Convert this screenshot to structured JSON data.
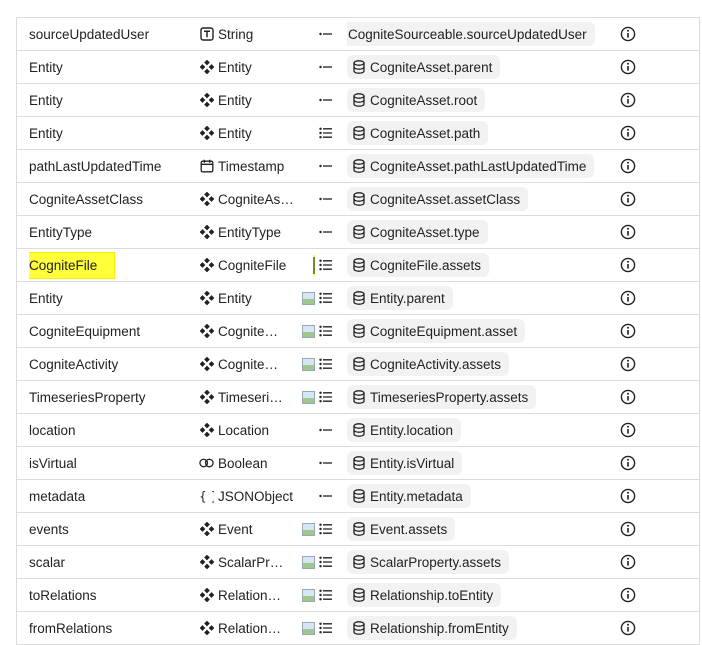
{
  "rows": [
    {
      "name": "sourceUpdatedUser",
      "type_icon": "text-icon",
      "type": "String",
      "indicator": "dash",
      "source": "CogniteSourceable.sourceUpdatedUser",
      "wide": true
    },
    {
      "name": "Entity",
      "type_icon": "node-icon",
      "type": "Entity",
      "indicator": "dash",
      "source": "CogniteAsset.parent"
    },
    {
      "name": "Entity",
      "type_icon": "node-icon",
      "type": "Entity",
      "indicator": "dash",
      "source": "CogniteAsset.root"
    },
    {
      "name": "Entity",
      "type_icon": "node-icon",
      "type": "Entity",
      "indicator": "list",
      "source": "CogniteAsset.path"
    },
    {
      "name": "pathLastUpdatedTime",
      "type_icon": "calendar-icon",
      "type": "Timestamp",
      "indicator": "dash",
      "source": "CogniteAsset.pathLastUpdatedTime"
    },
    {
      "name": "CogniteAssetClass",
      "type_icon": "node-icon",
      "type": "CogniteAss…",
      "indicator": "dash",
      "source": "CogniteAsset.assetClass"
    },
    {
      "name": "EntityType",
      "type_icon": "node-icon",
      "type": "EntityType",
      "indicator": "dash",
      "source": "CogniteAsset.type"
    },
    {
      "name": "CogniteFile",
      "type_icon": "node-icon",
      "type": "CogniteFile",
      "indicator": "image-list",
      "source": "CogniteFile.assets",
      "highlighted": true
    },
    {
      "name": "Entity",
      "type_icon": "node-icon",
      "type": "Entity",
      "indicator": "image-list",
      "source": "Entity.parent"
    },
    {
      "name": "CogniteEquipment",
      "type_icon": "node-icon",
      "type": "Cognite…",
      "indicator": "image-list",
      "source": "CogniteEquipment.asset"
    },
    {
      "name": "CogniteActivity",
      "type_icon": "node-icon",
      "type": "Cognite…",
      "indicator": "image-list",
      "source": "CogniteActivity.assets"
    },
    {
      "name": "TimeseriesProperty",
      "type_icon": "node-icon",
      "type": "Timeseri…",
      "indicator": "image-list",
      "source": "TimeseriesProperty.assets"
    },
    {
      "name": "location",
      "type_icon": "node-icon",
      "type": "Location",
      "indicator": "dash",
      "source": "Entity.location"
    },
    {
      "name": "isVirtual",
      "type_icon": "toggle-icon",
      "type": "Boolean",
      "indicator": "dash",
      "source": "Entity.isVirtual"
    },
    {
      "name": "metadata",
      "type_icon": "braces-icon",
      "type": "JSONObject",
      "indicator": "dash",
      "source": "Entity.metadata"
    },
    {
      "name": "events",
      "type_icon": "node-icon",
      "type": "Event",
      "indicator": "image-list",
      "source": "Event.assets"
    },
    {
      "name": "scalar",
      "type_icon": "node-icon",
      "type": "ScalarPr…",
      "indicator": "image-list",
      "source": "ScalarProperty.assets"
    },
    {
      "name": "toRelations",
      "type_icon": "node-icon",
      "type": "Relation…",
      "indicator": "image-list",
      "source": "Relationship.toEntity"
    },
    {
      "name": "fromRelations",
      "type_icon": "node-icon",
      "type": "Relation…",
      "indicator": "image-list",
      "source": "Relationship.fromEntity"
    }
  ],
  "colors": {
    "highlight": "#ffff3a",
    "chip_bg": "#f2f2f2",
    "border": "#dcdcdc"
  }
}
